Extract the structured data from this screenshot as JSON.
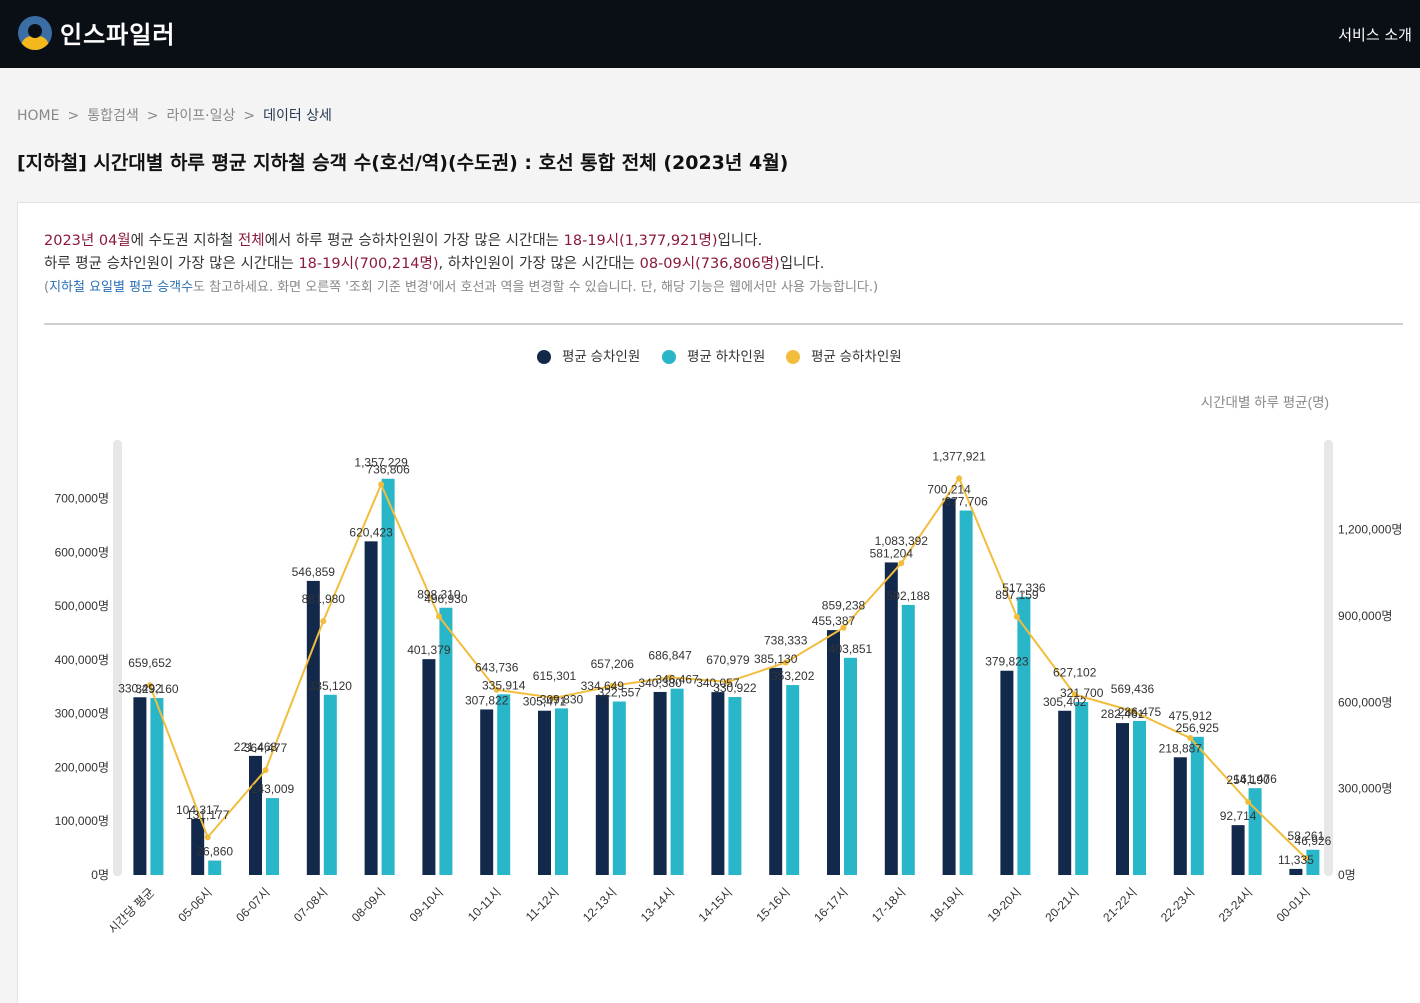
{
  "header": {
    "logo_text": "인스파일러",
    "service_link": "서비스 소개"
  },
  "breadcrumb": [
    "HOME",
    "통합검색",
    "라이프·일상",
    "데이터 상세"
  ],
  "page_title": "[지하철] 시간대별 하루 평균 지하철 승객 수(호선/역)(수도권) : 호선 통합 전체 (2023년 4월)",
  "summary": {
    "l1_month": "2023년 04월",
    "l1_t1": "에 수도권 지하철 ",
    "l1_all": "전체",
    "l1_t2": "에서 하루 평균 승하차인원이 가장 많은 시간대는 ",
    "l1_peak": "18-19시(1,377,921명)",
    "l1_t3": "입니다.",
    "l2_t1": "하루 평균 승차인원이 가장 많은 시간대는 ",
    "l2_board": "18-19시(700,214명)",
    "l2_t2": ", 하차인원이 가장 많은 시간대는 ",
    "l2_alight": "08-09시(736,806명)",
    "l2_t3": "입니다.",
    "n_open": "(",
    "n_link": "지하철 요일별 평균 승객수",
    "n_rest": "도 참고하세요. 화면 오른쪽 '조회 기준 변경'에서 호선과 역을 변경할 수 있습니다. 단, 해당 기능은 웹에서만 사용 가능합니다.)"
  },
  "chart_data": {
    "type": "bar",
    "unit_label": "시간대별 하루 평균(명)",
    "categories": [
      "시간당 평균",
      "05-06시",
      "06-07시",
      "07-08시",
      "08-09시",
      "09-10시",
      "10-11시",
      "11-12시",
      "12-13시",
      "13-14시",
      "14-15시",
      "15-16시",
      "16-17시",
      "17-18시",
      "18-19시",
      "19-20시",
      "20-21시",
      "21-22시",
      "22-23시",
      "23-24시",
      "00-01시"
    ],
    "series": [
      {
        "name": "평균 승차인원",
        "type": "bar",
        "axis": "left",
        "color": "#13294b",
        "values": [
          330492,
          104317,
          221468,
          546859,
          620423,
          401379,
          307822,
          305471,
          334649,
          340380,
          340057,
          385130,
          455387,
          581204,
          700214,
          379823,
          305402,
          282461,
          218887,
          92714,
          11335
        ],
        "labels": [
          "330,492",
          "104,317",
          "221,468",
          "546,859",
          "620,423",
          "401,379",
          "307,822",
          "305,471",
          "334,649",
          "340,380",
          "340,057",
          "385,130",
          "455,387",
          "581,204",
          "700,214",
          "379,823",
          "305,402",
          "282,461",
          "218,887",
          "92,714",
          "11,335"
        ]
      },
      {
        "name": "평균 하차인원",
        "type": "bar",
        "axis": "left",
        "color": "#29b6c9",
        "values": [
          329160,
          26860,
          143009,
          335120,
          736806,
          496930,
          335914,
          309830,
          322557,
          346467,
          330922,
          353202,
          403851,
          502188,
          677706,
          517336,
          321700,
          286475,
          256925,
          161476,
          46926
        ],
        "labels": [
          "329,160",
          "26,860",
          "143,009",
          "335,120",
          "736,806",
          "496,930",
          "335,914",
          "309,830",
          "322,557",
          "346,467",
          "330,922",
          "353,202",
          "403,851",
          "502,188",
          "677,706",
          "517,336",
          "321,700",
          "286,475",
          "256,925",
          "161,476",
          "46,926"
        ]
      },
      {
        "name": "평균 승하차인원",
        "type": "line",
        "axis": "right",
        "color": "#f2bd3c",
        "values": [
          659652,
          131177,
          364477,
          881980,
          1357229,
          898310,
          643736,
          615301,
          657206,
          686847,
          670979,
          738333,
          859238,
          1083392,
          1377921,
          897159,
          627102,
          569436,
          475912,
          254190,
          58261
        ],
        "labels": [
          "659,652",
          "131,177",
          "364,477",
          "881,980",
          "1,357,229",
          "898,310",
          "643,736",
          "615,301",
          "657,206",
          "686,847",
          "670,979",
          "738,333",
          "859,238",
          "1,083,392",
          "1,377,921",
          "897,159",
          "627,102",
          "569,436",
          "475,912",
          "254,190",
          "58,261"
        ]
      }
    ],
    "y_left": {
      "ylim": [
        0,
        800000
      ],
      "ticks": [
        "0명",
        "100,000명",
        "200,000명",
        "300,000명",
        "400,000명",
        "500,000명",
        "600,000명",
        "700,000명"
      ]
    },
    "y_right": {
      "ylim": [
        0,
        1500000
      ],
      "ticks": [
        "0명",
        "300,000명",
        "600,000명",
        "900,000명",
        "1,200,000명"
      ]
    },
    "legend_position": "top-center",
    "grid": false
  }
}
